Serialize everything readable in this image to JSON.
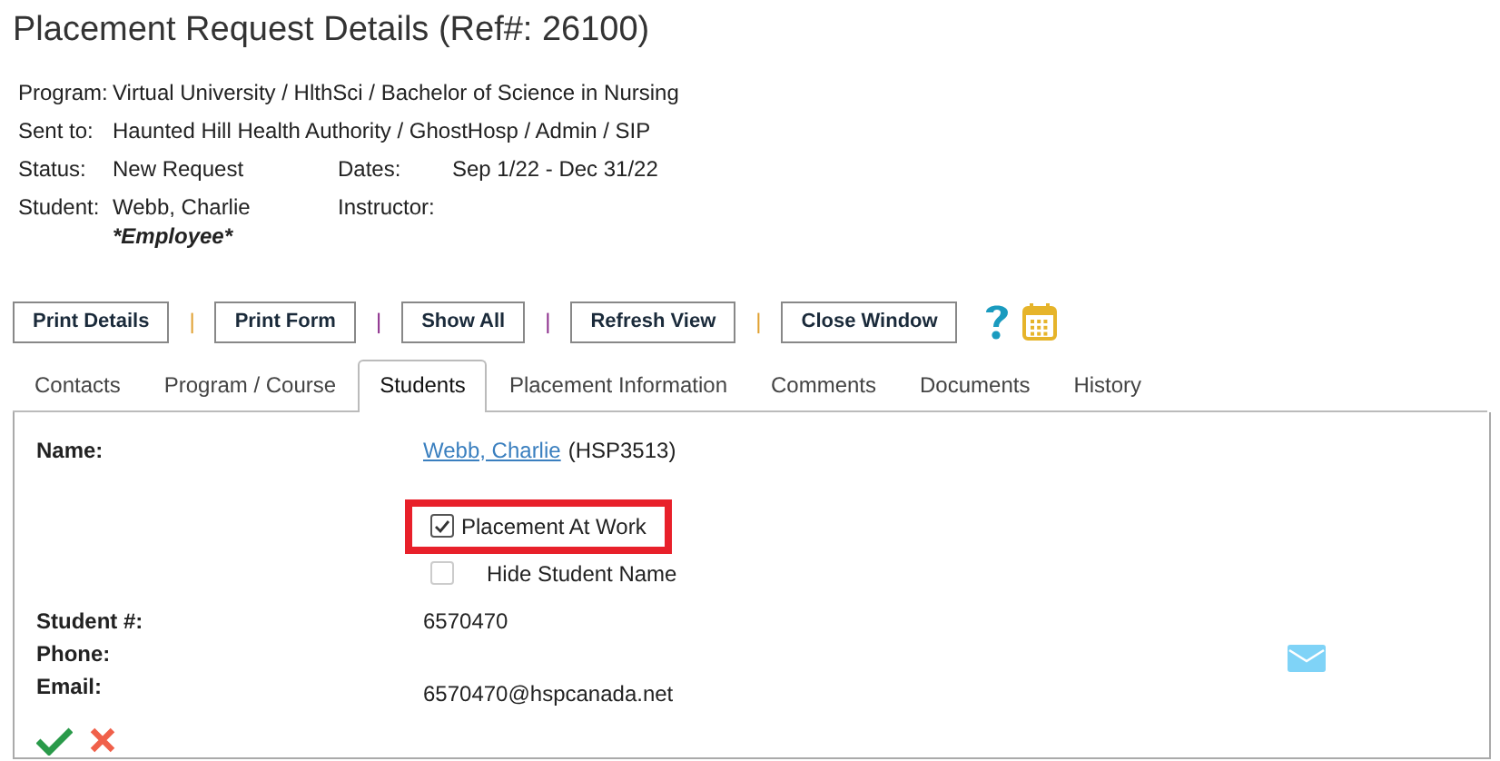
{
  "title": "Placement Request Details (Ref#: 26100)",
  "summary": {
    "program": {
      "label": "Program:",
      "value": "Virtual University / HlthSci / Bachelor of Science in Nursing"
    },
    "sent_to": {
      "label": "Sent to:",
      "value": "Haunted Hill Health Authority / GhostHosp / Admin / SIP"
    },
    "status": {
      "label": "Status:",
      "value": "New Request"
    },
    "dates": {
      "label": "Dates:",
      "value": "Sep 1/22 - Dec 31/22"
    },
    "student": {
      "label": "Student:",
      "value": "Webb, Charlie",
      "note": "*Employee*"
    },
    "instructor": {
      "label": "Instructor:"
    }
  },
  "toolbar": [
    {
      "kind": "button",
      "label": "Print Details"
    },
    {
      "kind": "separator",
      "text": "|",
      "color": "#e0a030"
    },
    {
      "kind": "button",
      "label": "Print Form"
    },
    {
      "kind": "separator",
      "text": "|",
      "color": "#8a2a8a"
    },
    {
      "kind": "button",
      "label": "Show All"
    },
    {
      "kind": "separator",
      "text": "|",
      "color": "#8a2a8a"
    },
    {
      "kind": "button",
      "label": "Refresh View"
    },
    {
      "kind": "separator",
      "text": "|",
      "color": "#e0a030"
    },
    {
      "kind": "button",
      "label": "Close Window"
    }
  ],
  "tabs": [
    {
      "label": "Contacts",
      "selected": false
    },
    {
      "label": "Program / Course",
      "selected": false
    },
    {
      "label": "Students",
      "selected": true
    },
    {
      "label": "Placement Information",
      "selected": false
    },
    {
      "label": "Comments",
      "selected": false
    },
    {
      "label": "Documents",
      "selected": false
    },
    {
      "label": "History",
      "selected": false
    }
  ],
  "student_panel": {
    "name_label": "Name:",
    "name_link": "Webb, Charlie",
    "name_code": "(HSP3513)",
    "options": [
      {
        "label": "Placement At Work",
        "checked": true,
        "highlighted": true
      },
      {
        "label": "Hide Student Name",
        "checked": false,
        "highlighted": false
      }
    ],
    "fields": [
      {
        "label": "Student #:",
        "value": "6570470"
      },
      {
        "label": "Phone:"
      },
      {
        "label": "Email:",
        "value": "6570470@hspcanada.net"
      }
    ]
  }
}
